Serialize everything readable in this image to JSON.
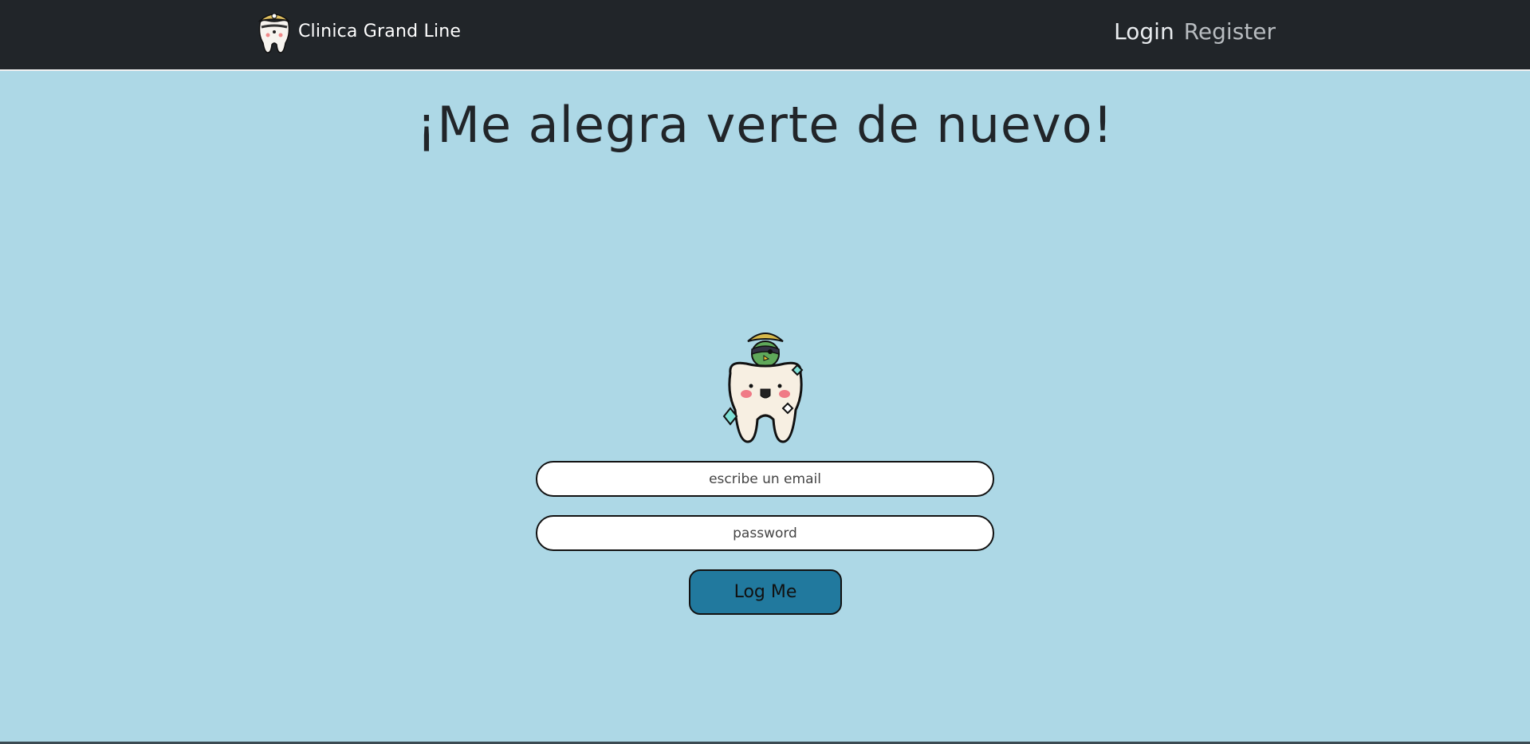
{
  "navbar": {
    "brand_name": "Clinica Grand Line",
    "links": {
      "login": "Login",
      "register": "Register"
    },
    "background_color": "#212529"
  },
  "main": {
    "title": "¡Me alegra verte de nuevo!",
    "mascot_icon": "tooth-pirate-mascot",
    "form": {
      "email_placeholder": "escribe un email",
      "email_value": "",
      "password_placeholder": "password",
      "password_value": "",
      "submit_label": "Log Me"
    },
    "background_color": "#add8e6",
    "button_color": "#21799e"
  }
}
